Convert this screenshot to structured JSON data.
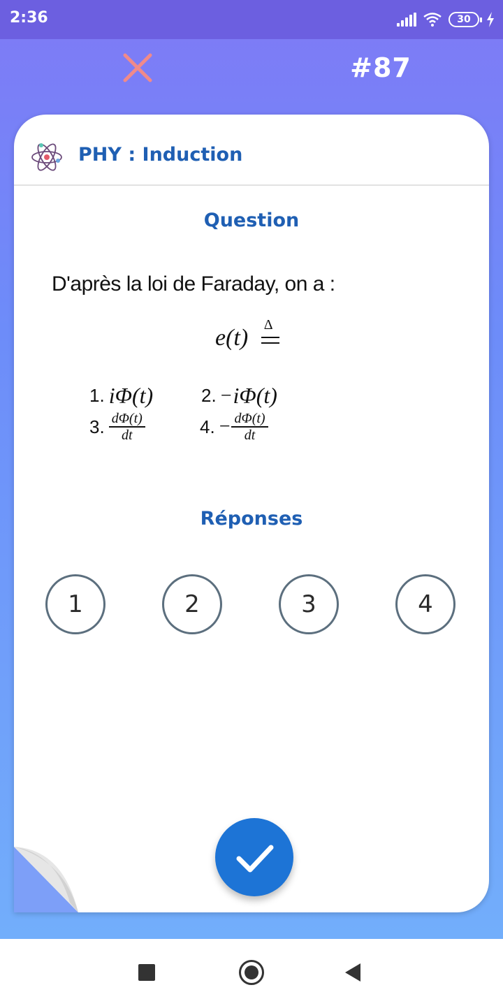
{
  "status_bar": {
    "time": "2:36",
    "battery": "30",
    "icons": [
      "signal-icon",
      "wifi-icon",
      "battery-icon",
      "charging-icon"
    ]
  },
  "top_bar": {
    "close_icon": "close-icon",
    "question_number": "#87"
  },
  "card": {
    "subject_icon": "atom-icon",
    "title": "PHY : Induction",
    "question_heading": "Question",
    "question_text": "D'après la loi de Faraday, on a :",
    "equation": {
      "lhs": "e(t)",
      "defeq_symbol": "Δ"
    },
    "options": [
      {
        "num": "1.",
        "expr": "iΦ(t)"
      },
      {
        "num": "2.",
        "sign": "−",
        "expr": "iΦ(t)"
      },
      {
        "num": "3.",
        "numerator": "dΦ(t)",
        "denominator": "dt"
      },
      {
        "num": "4.",
        "sign": "−",
        "numerator": "dΦ(t)",
        "denominator": "dt"
      }
    ],
    "answers_heading": "Réponses",
    "answer_choices": [
      "1",
      "2",
      "3",
      "4"
    ],
    "submit_icon": "check-icon"
  },
  "colors": {
    "accent": "#1f5fb3",
    "submit": "#1d74d6",
    "close": "#f08a8a",
    "choice_border": "#5c6f7e"
  },
  "nav_bar": {
    "icons": [
      "recents-icon",
      "home-icon",
      "back-icon"
    ]
  }
}
